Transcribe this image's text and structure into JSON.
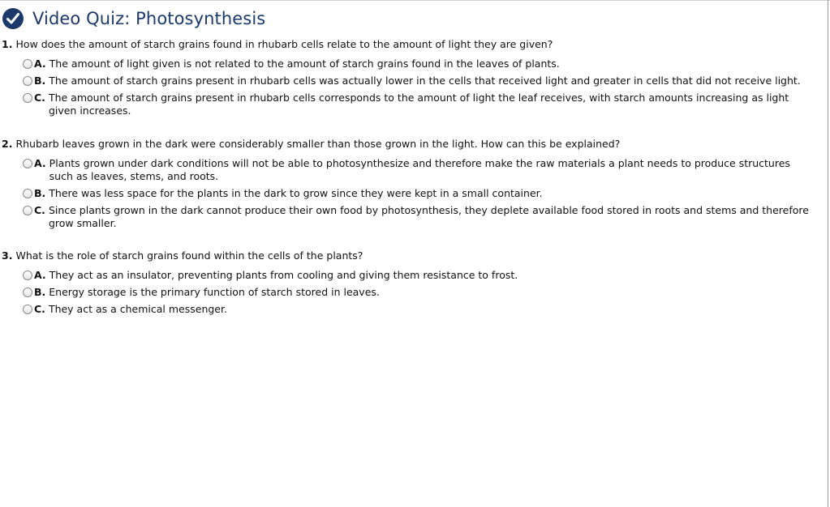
{
  "quiz": {
    "title": "Video Quiz: Photosynthesis",
    "title_color": "#1b3a6b",
    "completed_icon": "check-circle-icon",
    "questions": [
      {
        "number": "1.",
        "text": "How does the amount of starch grains found in rhubarb cells relate to the amount of light they are given?",
        "choices": [
          {
            "letter": "A.",
            "text": "The amount of light given is not related to the amount of starch grains found in the leaves of plants."
          },
          {
            "letter": "B.",
            "text": "The amount of starch grains present in rhubarb cells was actually lower in the cells that received light and greater in cells that did not receive light."
          },
          {
            "letter": "C.",
            "text": "The amount of starch grains present in rhubarb cells corresponds to the amount of light the leaf receives, with starch amounts increasing as light given increases."
          }
        ]
      },
      {
        "number": "2.",
        "text": "Rhubarb leaves grown in the dark were considerably smaller than those grown in the light. How can this be explained?",
        "choices": [
          {
            "letter": "A.",
            "text": "Plants grown under dark conditions will not be able to photosynthesize and therefore make the raw materials a plant needs to produce structures such as leaves, stems, and roots."
          },
          {
            "letter": "B.",
            "text": "There was less space for the plants in the dark to grow since they were kept in a small container."
          },
          {
            "letter": "C.",
            "text": "Since plants grown in the dark cannot produce their own food by photosynthesis, they deplete available food stored in roots and stems and therefore grow smaller."
          }
        ]
      },
      {
        "number": "3.",
        "text": "What is the role of starch grains found within the cells of the plants?",
        "choices": [
          {
            "letter": "A.",
            "text": "They act as an insulator, preventing plants from cooling and giving them resistance to frost."
          },
          {
            "letter": "B.",
            "text": "Energy storage is the primary function of starch stored in leaves."
          },
          {
            "letter": "C.",
            "text": "They act as a chemical messenger."
          }
        ]
      }
    ]
  }
}
